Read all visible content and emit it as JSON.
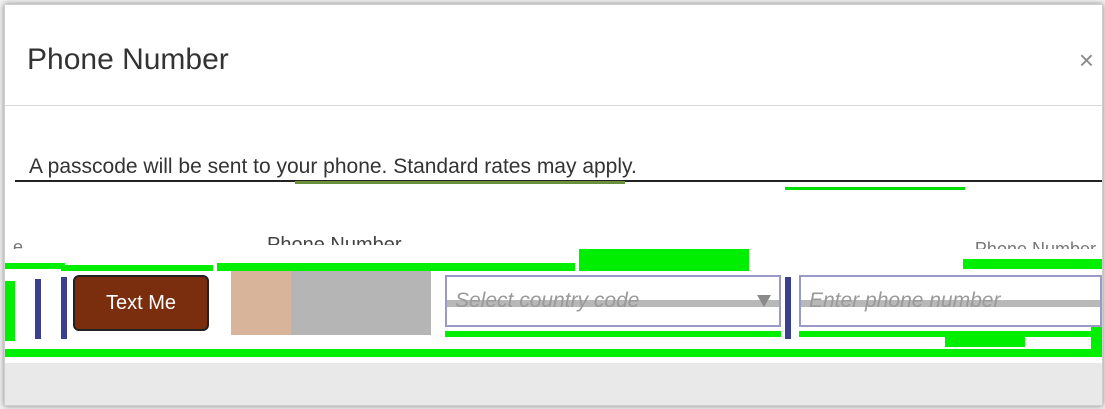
{
  "dialog": {
    "title": "Phone Number",
    "close_glyph": "×"
  },
  "notice": "A passcode will be sent to your phone. Standard rates may apply.",
  "form": {
    "phone_label": "Phone Number",
    "text_me_label": "Text Me",
    "country_placeholder": "Select country code",
    "phone_placeholder": "Enter phone number"
  },
  "colors": {
    "primary_button": "#7b2e0e",
    "glitch_green": "#00ee00"
  },
  "icons": {
    "close": "close-icon",
    "dropdown": "chevron-down-icon"
  }
}
